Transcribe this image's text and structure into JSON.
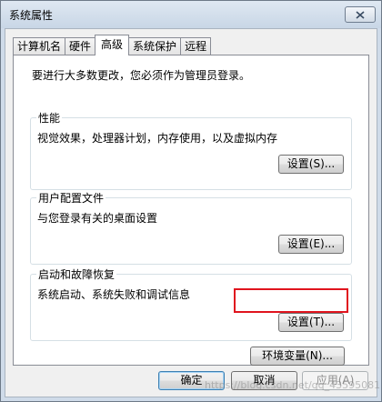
{
  "window": {
    "title": "系统属性"
  },
  "tabs": [
    {
      "label": "计算机名"
    },
    {
      "label": "硬件"
    },
    {
      "label": "高级"
    },
    {
      "label": "系统保护"
    },
    {
      "label": "远程"
    }
  ],
  "panel": {
    "info": "要进行大多数更改，您必须作为管理员登录。",
    "groups": [
      {
        "title": "性能",
        "desc": "视觉效果，处理器计划，内存使用，以及虚拟内存",
        "button": "设置(S)..."
      },
      {
        "title": "用户配置文件",
        "desc": "与您登录有关的桌面设置",
        "button": "设置(E)..."
      },
      {
        "title": "启动和故障恢复",
        "desc": "系统启动、系统失败和调试信息",
        "button": "设置(T)..."
      }
    ],
    "env_button": "环境变量(N)..."
  },
  "footer": {
    "ok": "确定",
    "cancel": "取消",
    "apply": "应用(A)"
  },
  "watermark": "https://blog.csdn.net/qq_43595081",
  "colors": {
    "highlight": "#e0141e",
    "title_bar": "#cfdbe9"
  }
}
